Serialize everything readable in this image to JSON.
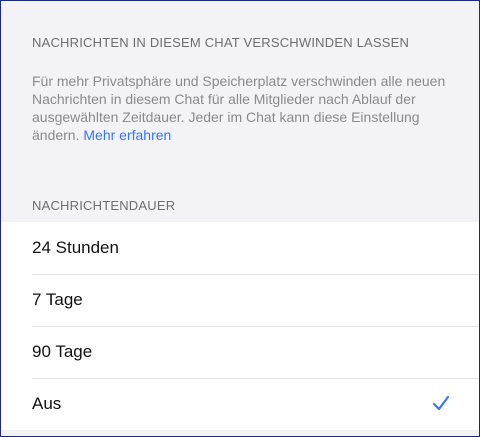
{
  "section": {
    "title": "NACHRICHTEN IN DIESEM CHAT VERSCHWINDEN LASSEN",
    "description": "Für mehr Privatsphäre und Speicherplatz verschwinden alle neuen Nachrichten in diesem Chat für alle Mitglieder nach Ablauf der ausgewählten Zeitdauer. Jeder im Chat kann diese Einstellung ändern.",
    "more_link": "Mehr erfahren"
  },
  "duration": {
    "header": "NACHRICHTENDAUER",
    "options": [
      {
        "label": "24 Stunden",
        "selected": false
      },
      {
        "label": "7 Tage",
        "selected": false
      },
      {
        "label": "90 Tage",
        "selected": false
      },
      {
        "label": "Aus",
        "selected": true
      }
    ]
  },
  "colors": {
    "accent": "#3478f6",
    "background": "#f2f2f7"
  }
}
